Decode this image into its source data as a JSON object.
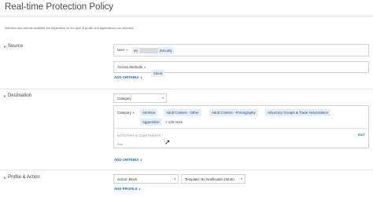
{
  "page": {
    "title": "Real-time Protection Policy",
    "subtitle": "Activities and actions available are dependent on the type of profile and applications you selected."
  },
  "source": {
    "heading": "Source",
    "user_label": "User",
    "user_op": "as",
    "user_value": "Security",
    "access_label": "Access Methods",
    "access_value": "Client",
    "add_criteria": "ADD CRITERIA"
  },
  "destination": {
    "heading": "Destination",
    "type_select": "Category",
    "category_label": "Category",
    "chips": [
      "Abortion",
      "Adult Content - Other",
      "Adult Content - Pornography",
      "Advocacy Groups & Trade Associations",
      "Aggressive"
    ],
    "more": "+ 125 more",
    "activities_label": "ACTIVITIES & CONSTRAINTS",
    "edit": "EDIT",
    "activities_value": "Any",
    "add_criteria": "ADD CRITERIA"
  },
  "profile_action": {
    "heading": "Profile & Action",
    "action_value": "Action: Block",
    "template_value": "Template: No Notification (Mute)",
    "add_profile": "ADD PROFILE"
  },
  "icons": {
    "caret": "caret-down-icon",
    "dropdown": "dropdown-arrow-icon",
    "cursor": "mouse-cursor-icon"
  },
  "colors": {
    "link": "#1f6fb4",
    "chip_bg": "#e3eef7",
    "border": "#cfd3d7"
  }
}
